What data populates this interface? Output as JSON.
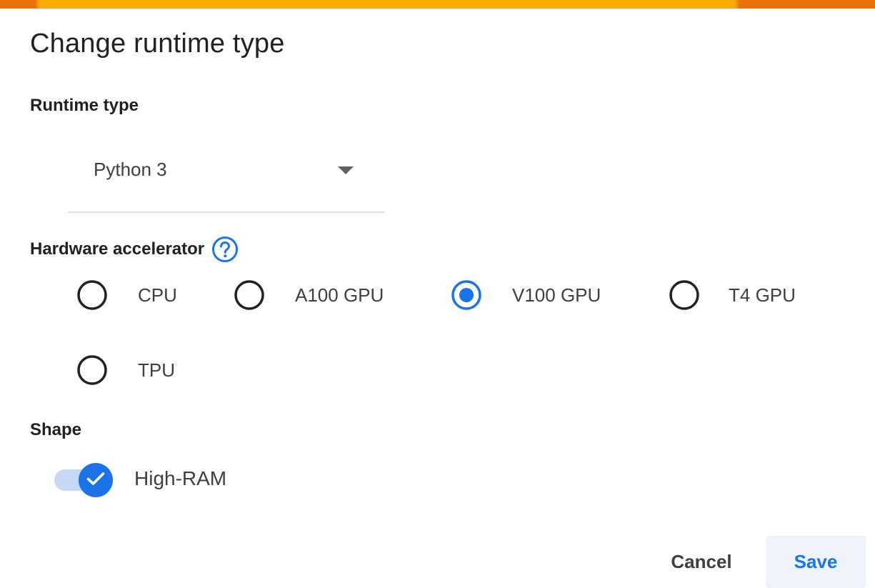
{
  "dialog": {
    "title": "Change runtime type",
    "accent_color": "#f9ab00",
    "accent_edge_color": "#e8710a"
  },
  "runtime_type": {
    "label": "Runtime type",
    "selected": "Python 3",
    "dropdown_icon": "caret-down-icon"
  },
  "hardware_accelerator": {
    "label": "Hardware accelerator",
    "help_icon": "help-circle-icon",
    "options": [
      {
        "label": "CPU",
        "selected": false
      },
      {
        "label": "A100 GPU",
        "selected": false
      },
      {
        "label": "V100 GPU",
        "selected": true
      },
      {
        "label": "T4 GPU",
        "selected": false
      },
      {
        "label": "TPU",
        "selected": false
      }
    ],
    "selected_color": "#1a73e8"
  },
  "shape": {
    "label": "Shape",
    "toggle_label": "High-RAM",
    "toggle_on": true
  },
  "actions": {
    "cancel_label": "Cancel",
    "save_label": "Save"
  }
}
